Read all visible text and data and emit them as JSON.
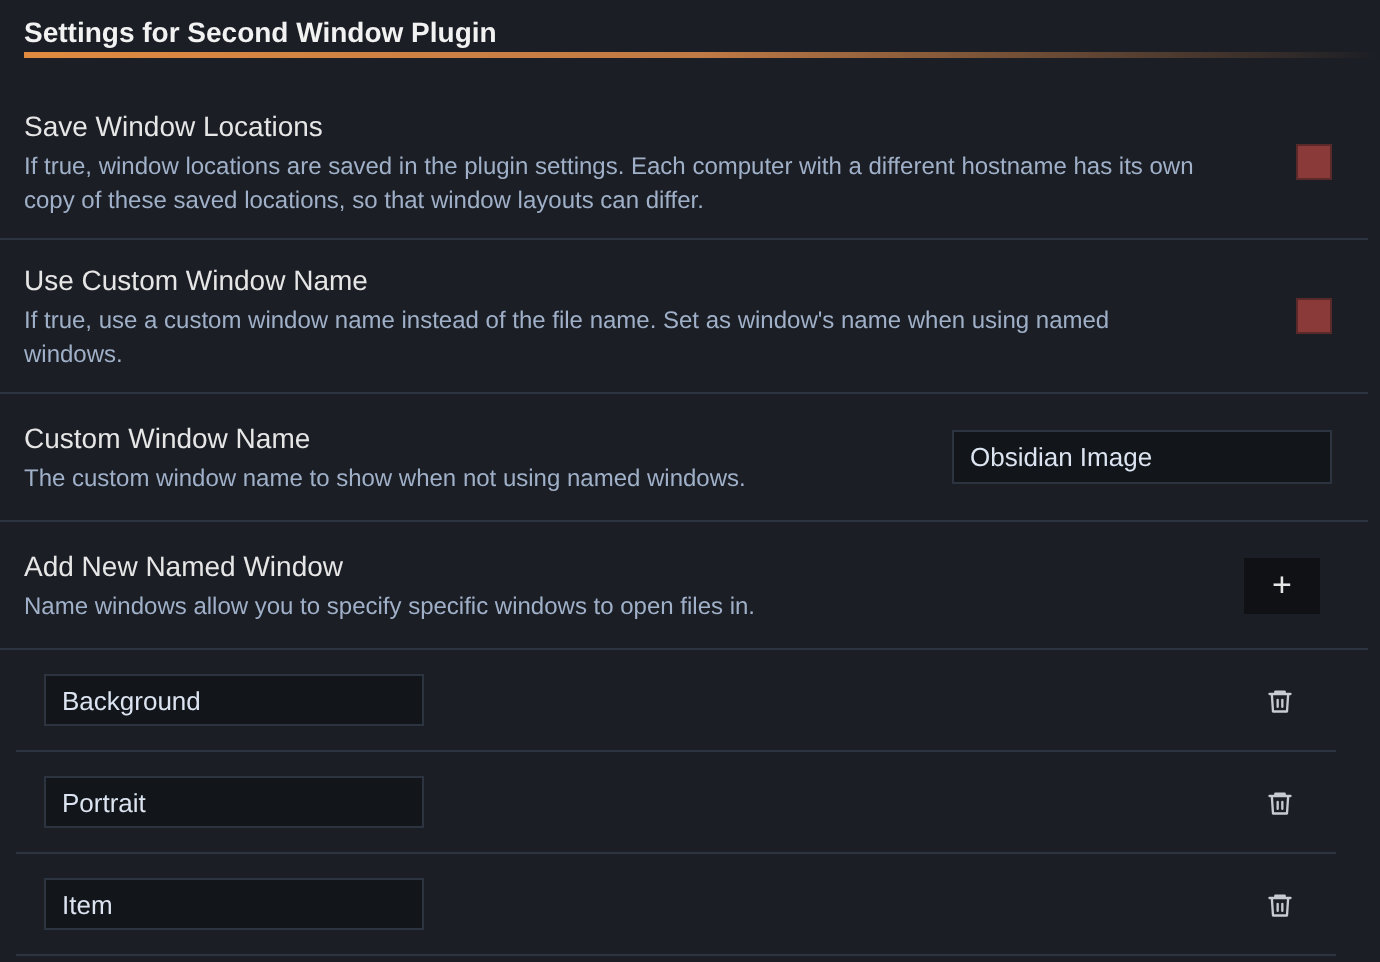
{
  "heading": "Settings for Second Window Plugin",
  "settings": [
    {
      "kind": "checkbox",
      "name": "Save Window Locations",
      "description": "If true, window locations are saved in the plugin settings. Each computer with a different hostname has its own copy of these saved locations, so that window layouts can differ.",
      "checked": true
    },
    {
      "kind": "checkbox",
      "name": "Use Custom Window Name",
      "description": "If true, use a custom window name instead of the file name. Set as window's name when using named windows.",
      "checked": true
    },
    {
      "kind": "text",
      "name": "Custom Window Name",
      "description": "The custom window name to show when not using named windows.",
      "value": "Obsidian Image"
    },
    {
      "kind": "add",
      "name": "Add New Named Window",
      "description": "Name windows allow you to specify specific windows to open files in.",
      "button": "+"
    }
  ],
  "named_windows": [
    {
      "value": "Background"
    },
    {
      "value": "Portrait"
    },
    {
      "value": "Item"
    }
  ]
}
